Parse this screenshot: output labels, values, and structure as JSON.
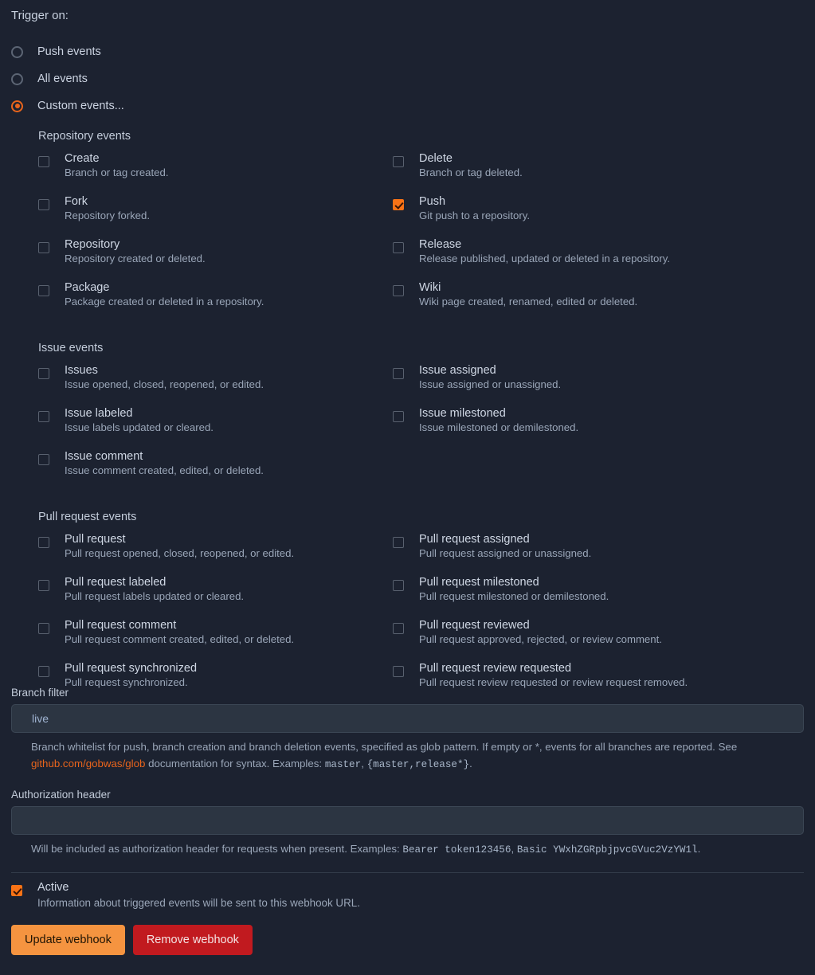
{
  "trigger": {
    "label": "Trigger on:",
    "options": [
      {
        "label": "Push events",
        "checked": false
      },
      {
        "label": "All events",
        "checked": false
      },
      {
        "label": "Custom events...",
        "checked": true
      }
    ]
  },
  "groups": [
    {
      "title": "Repository events",
      "items": [
        {
          "title": "Create",
          "desc": "Branch or tag created.",
          "checked": false
        },
        {
          "title": "Delete",
          "desc": "Branch or tag deleted.",
          "checked": false
        },
        {
          "title": "Fork",
          "desc": "Repository forked.",
          "checked": false
        },
        {
          "title": "Push",
          "desc": "Git push to a repository.",
          "checked": true
        },
        {
          "title": "Repository",
          "desc": "Repository created or deleted.",
          "checked": false
        },
        {
          "title": "Release",
          "desc": "Release published, updated or deleted in a repository.",
          "checked": false
        },
        {
          "title": "Package",
          "desc": "Package created or deleted in a repository.",
          "checked": false
        },
        {
          "title": "Wiki",
          "desc": "Wiki page created, renamed, edited or deleted.",
          "checked": false
        }
      ]
    },
    {
      "title": "Issue events",
      "items": [
        {
          "title": "Issues",
          "desc": "Issue opened, closed, reopened, or edited.",
          "checked": false
        },
        {
          "title": "Issue assigned",
          "desc": "Issue assigned or unassigned.",
          "checked": false
        },
        {
          "title": "Issue labeled",
          "desc": "Issue labels updated or cleared.",
          "checked": false
        },
        {
          "title": "Issue milestoned",
          "desc": "Issue milestoned or demilestoned.",
          "checked": false
        },
        {
          "title": "Issue comment",
          "desc": "Issue comment created, edited, or deleted.",
          "checked": false
        },
        {
          "title": "",
          "desc": "",
          "checked": false
        }
      ]
    },
    {
      "title": "Pull request events",
      "items": [
        {
          "title": "Pull request",
          "desc": "Pull request opened, closed, reopened, or edited.",
          "checked": false
        },
        {
          "title": "Pull request assigned",
          "desc": "Pull request assigned or unassigned.",
          "checked": false
        },
        {
          "title": "Pull request labeled",
          "desc": "Pull request labels updated or cleared.",
          "checked": false
        },
        {
          "title": "Pull request milestoned",
          "desc": "Pull request milestoned or demilestoned.",
          "checked": false
        },
        {
          "title": "Pull request comment",
          "desc": "Pull request comment created, edited, or deleted.",
          "checked": false
        },
        {
          "title": "Pull request reviewed",
          "desc": "Pull request approved, rejected, or review comment.",
          "checked": false
        },
        {
          "title": "Pull request synchronized",
          "desc": "Pull request synchronized.",
          "checked": false
        },
        {
          "title": "Pull request review requested",
          "desc": "Pull request review requested or review request removed.",
          "checked": false
        }
      ]
    }
  ],
  "branch_filter": {
    "label": "Branch filter",
    "value": "live",
    "placeholder": "",
    "help_part1": "Branch whitelist for push, branch creation and branch deletion events, specified as glob pattern. If empty or *, events for all branches are reported. See ",
    "link_text": "github.com/gobwas/glob",
    "help_part2": " documentation for syntax. Examples: ",
    "example1": "master",
    "help_sep": ", ",
    "example2": "{master,release*}",
    "help_end": "."
  },
  "authorization_header": {
    "label": "Authorization header",
    "value": "",
    "placeholder": "",
    "help_part1": "Will be included as authorization header for requests when present. Examples: ",
    "example1": "Bearer token123456",
    "help_sep": ", ",
    "example2": "Basic YWxhZGRpbjpvcGVuc2VzYW1l",
    "help_end": "."
  },
  "active": {
    "title": "Active",
    "desc": "Information about triggered events will be sent to this webhook URL.",
    "checked": true
  },
  "buttons": {
    "update": "Update webhook",
    "remove": "Remove webhook"
  },
  "colors": {
    "background": "#1c2230",
    "accent_orange": "#f97316",
    "radio_accent": "#e8641c",
    "primary_button": "#f59440",
    "danger_button": "#c11a1f",
    "field_background": "#2c3542",
    "link": "#e8641c"
  }
}
